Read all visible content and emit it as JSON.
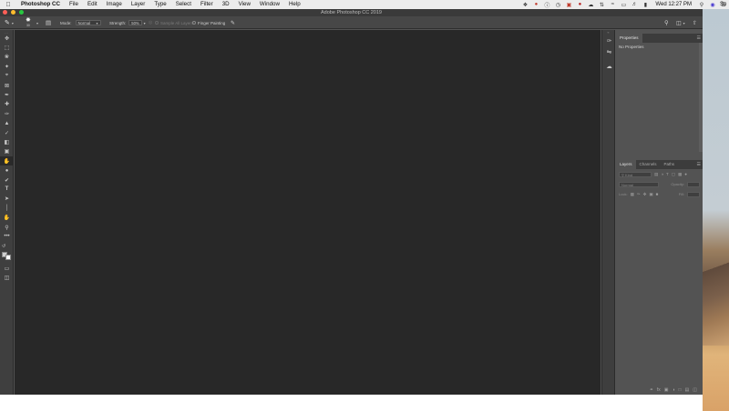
{
  "menubar": {
    "apple_icon": "apple-icon",
    "app_name": "Photoshop CC",
    "items": [
      "File",
      "Edit",
      "Image",
      "Layer",
      "Type",
      "Select",
      "Filter",
      "3D",
      "View",
      "Window",
      "Help"
    ],
    "clock": "Wed 12:27 PM",
    "edge_text": "So"
  },
  "window": {
    "title": "Adobe Photoshop CC 2019"
  },
  "options": {
    "brush_size": "30",
    "mode_label": "Mode:",
    "mode_value": "Normal",
    "strength_label": "Strength:",
    "strength_value": "50%",
    "sample_all_layers": "Sample All Layers",
    "finger_painting": "Finger Painting"
  },
  "properties_panel": {
    "tab": "Properties",
    "body_text": "No Properties"
  },
  "layers_panel": {
    "tabs": [
      "Layers",
      "Channels",
      "Paths"
    ],
    "kind_placeholder": "Kind",
    "blend_mode": "Normal",
    "opacity_label": "Opacity:",
    "lock_label": "Lock:",
    "fill_label": "Fill:"
  },
  "colors": {
    "canvas": "#282828",
    "chrome": "#535353",
    "toolbar": "#3f3f3f",
    "close": "#ff5f57",
    "minimize": "#febc2e",
    "zoom": "#28c840"
  }
}
